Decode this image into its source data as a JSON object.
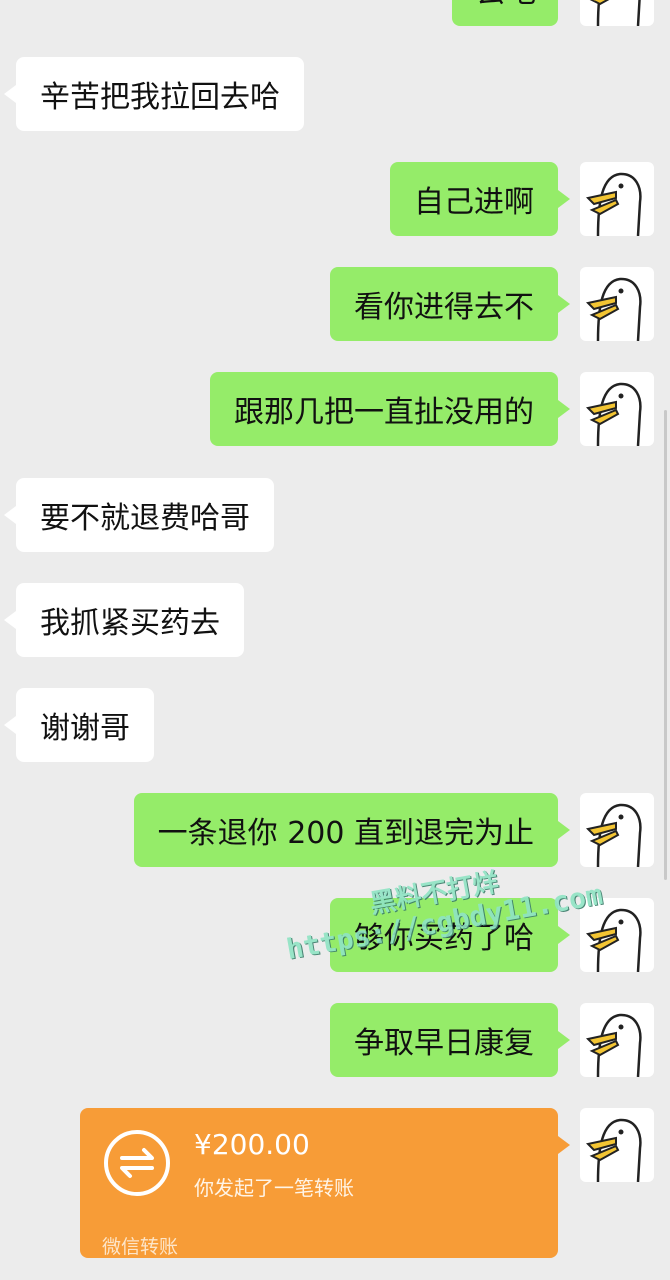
{
  "avatar": {
    "icon": "duck-avatar-icon"
  },
  "messages": [
    {
      "side": "out",
      "text": "去吧"
    },
    {
      "side": "in",
      "text": "辛苦把我拉回去哈"
    },
    {
      "side": "out",
      "text": "自己进啊"
    },
    {
      "side": "out",
      "text": "看你进得去不"
    },
    {
      "side": "out",
      "text": "跟那几把一直扯没用的"
    },
    {
      "side": "in",
      "text": "要不就退费哈哥"
    },
    {
      "side": "in",
      "text": "我抓紧买药去"
    },
    {
      "side": "in",
      "text": "谢谢哥"
    },
    {
      "side": "out",
      "text": "一条退你 200 直到退完为止"
    },
    {
      "side": "out",
      "text": "够你买药了哈"
    },
    {
      "side": "out",
      "text": "争取早日康复"
    }
  ],
  "transfer": {
    "amount": "¥200.00",
    "description": "你发起了一笔转账",
    "footer": "微信转账",
    "icon": "transfer-arrows-icon",
    "color": "#f79c37"
  },
  "watermark": {
    "line1": "黑料不打烊",
    "line2": "https://cgbdy11.com"
  },
  "colors": {
    "background": "#ececec",
    "incoming_bubble": "#ffffff",
    "outgoing_bubble": "#95ec69"
  }
}
